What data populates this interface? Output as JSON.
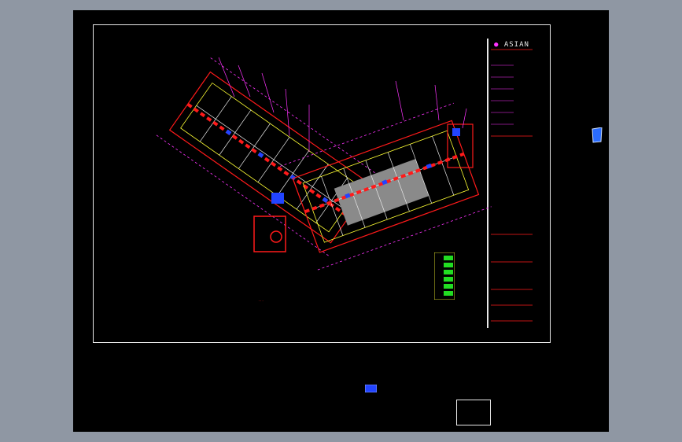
{
  "drawing": {
    "logo_text": "ASIAN",
    "plan_title": "..."
  },
  "colors": {
    "model_space_bg": "#000000",
    "app_bg": "#8f97a3",
    "frame_line": "#e8e8e8",
    "walls": "#ff1a1a",
    "dimensions": "#ff33ff",
    "columns": "#ffff33",
    "fixtures": "#2244ff",
    "hatch": "#8a8a8a",
    "legend": "#22dd22"
  }
}
